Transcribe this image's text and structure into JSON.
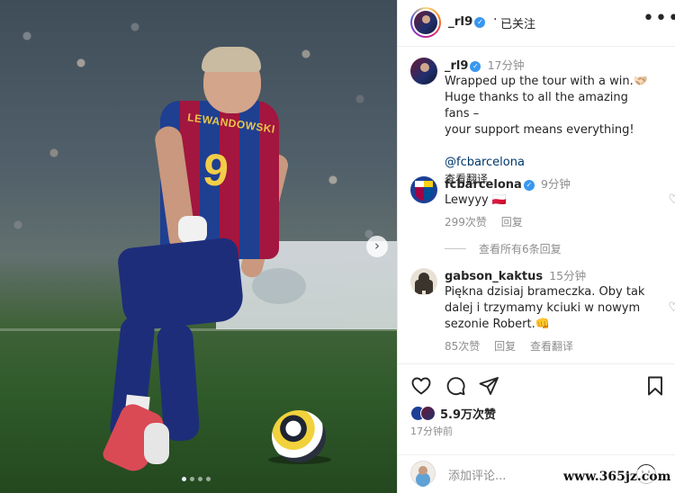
{
  "header": {
    "username": "_rl9",
    "separator": "·",
    "follow_state": "已关注",
    "more_icon": "more-icon"
  },
  "caption": {
    "username": "_rl9",
    "time": "17分钟",
    "lines": [
      "Wrapped up the tour with a win.🫱🏻‍🫲🏼",
      "Huge thanks to all the amazing fans –",
      "your support means everything!"
    ],
    "mention": "@fcbarcelona",
    "translate": "查看翻译"
  },
  "comments": [
    {
      "username": "fcbarcelona",
      "verified": true,
      "time": "9分钟",
      "text": "Lewyyy 🇵🇱",
      "likes": "299次赞",
      "reply": "回复"
    },
    {
      "username": "gabson_kaktus",
      "verified": false,
      "time": "15分钟",
      "text_lines": [
        "Piękna dzisiaj brameczka. Oby tak",
        "dalej i trzymamy kciuki w nowym",
        "sezonie Robert.👊"
      ],
      "likes": "85次赞",
      "reply": "回复",
      "translate": "查看翻译"
    }
  ],
  "view_replies": "查看所有6条回复",
  "actions": {
    "like_icon": "heart-icon",
    "comment_icon": "comment-icon",
    "share_icon": "share-icon",
    "save_icon": "bookmark-icon"
  },
  "likes_count": "5.9万次赞",
  "post_time": "17分钟前",
  "add_comment_placeholder": "添加评论...",
  "photo": {
    "jersey_name": "LEWANDOWSKI",
    "jersey_number": "9",
    "carousel_next_icon": "chevron-right-icon",
    "carousel": {
      "count": 4,
      "active_index": 0
    }
  },
  "watermark": "www.365jz.com"
}
